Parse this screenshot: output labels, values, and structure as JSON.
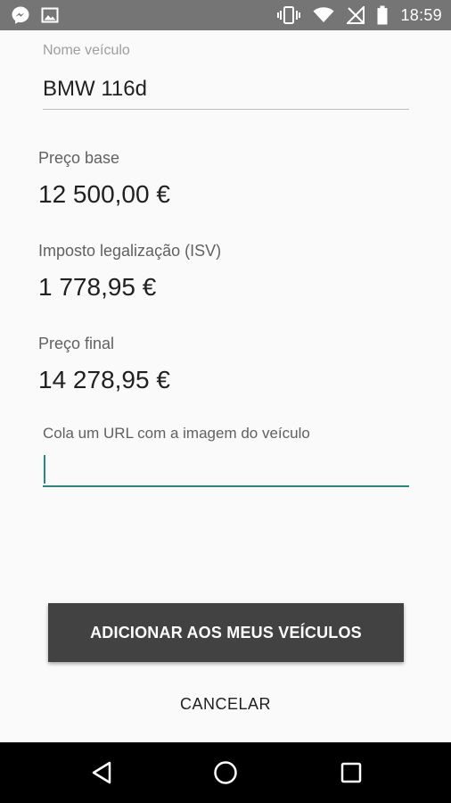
{
  "status_bar": {
    "time": "18:59",
    "icons": [
      "messenger-icon",
      "image-icon",
      "vibrate-icon",
      "wifi-icon",
      "no-signal-icon",
      "battery-icon"
    ]
  },
  "form": {
    "vehicle_name_label": "Nome veículo",
    "vehicle_name_value": "BMW 116d",
    "base_price_label": "Preço base",
    "base_price_value": "12 500,00 €",
    "tax_label": "Imposto legalização (ISV)",
    "tax_value": "1 778,95 €",
    "final_price_label": "Preço final",
    "final_price_value": "14 278,95 €",
    "url_label": "Cola um URL com a imagem do veículo",
    "url_value": ""
  },
  "actions": {
    "add_label": "ADICIONAR AOS MEUS VEÍCULOS",
    "cancel_label": "CANCELAR"
  },
  "nav": {
    "icons": [
      "back-icon",
      "home-icon",
      "recents-icon"
    ]
  },
  "colors": {
    "accent": "#26897b",
    "status_bar": "#757575",
    "button": "#424242"
  }
}
